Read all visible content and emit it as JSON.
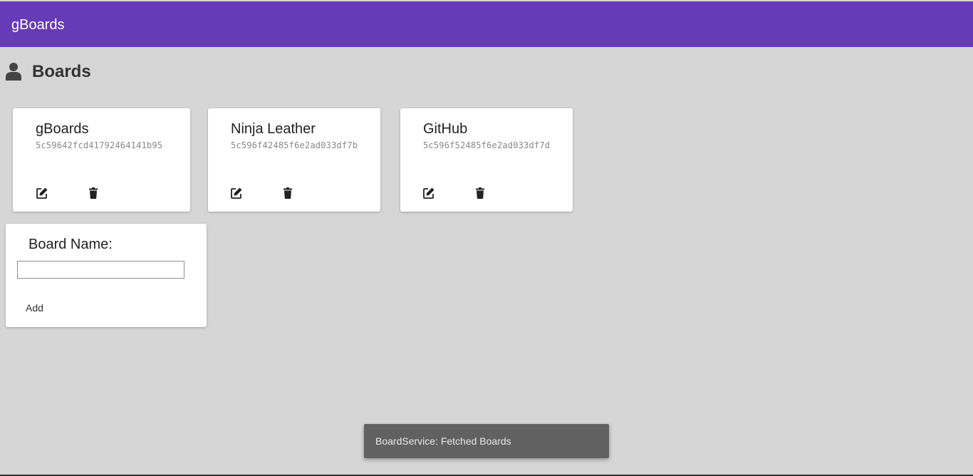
{
  "app": {
    "title": "gBoards",
    "brand_color": "#673ab7"
  },
  "page": {
    "icon": "user-icon",
    "title": "Boards"
  },
  "boards": [
    {
      "name": "gBoards",
      "id": "5c59642fcd41792464141b95",
      "edit_icon": "edit-icon",
      "delete_icon": "trash-icon"
    },
    {
      "name": "Ninja Leather",
      "id": "5c596f42485f6e2ad033df7b",
      "edit_icon": "edit-icon",
      "delete_icon": "trash-icon"
    },
    {
      "name": "GitHub",
      "id": "5c596f52485f6e2ad033df7d",
      "edit_icon": "edit-icon",
      "delete_icon": "trash-icon"
    }
  ],
  "add_form": {
    "label": "Board Name:",
    "value": "",
    "placeholder": "",
    "button_label": "Add"
  },
  "snackbar": {
    "message": "BoardService: Fetched Boards"
  }
}
